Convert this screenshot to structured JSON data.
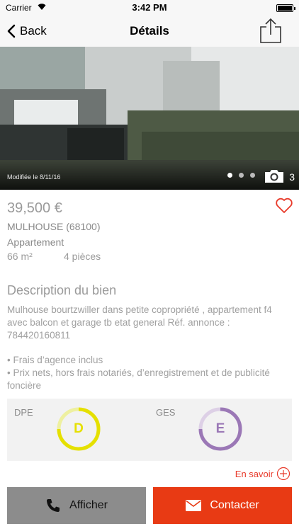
{
  "status_bar": {
    "carrier": "Carrier",
    "time": "3:42 PM",
    "battery_level": 1.0
  },
  "nav": {
    "back_label": "Back",
    "title": "Détails"
  },
  "photo": {
    "modified": "Modifiée le 8/11/16",
    "count": "3",
    "active_dot": 0
  },
  "listing": {
    "price": "39,500 €",
    "city": "MULHOUSE (68100)",
    "type": "Appartement",
    "area": "66 m²",
    "rooms": "4 pièces"
  },
  "description": {
    "title": "Description du bien",
    "text": "Mulhouse bourtzwiller   dans petite copropriété , appartement f4 avec balcon et garage tb etat general Réf. annonce : 784420160811",
    "bullet_1": "• Frais d’agence inclus",
    "bullet_2": "• Prix nets, hors frais notariés, d’enregistrement et de publicité foncière"
  },
  "energy": {
    "dpe_label": "DPE",
    "dpe_value": "D",
    "dpe_color": "#e5e000",
    "ges_label": "GES",
    "ges_value": "E",
    "ges_color": "#9b78b6"
  },
  "learn_more": "En savoir",
  "actions": {
    "show_label": "Afficher",
    "contact_label": "Contacter"
  },
  "colors": {
    "accent": "#e83a14",
    "heart": "#e83a2a",
    "show_button": "#8c8c8c"
  },
  "icons": [
    "wifi-icon",
    "battery-icon",
    "back-chevron-icon",
    "share-icon",
    "camera-icon",
    "heart-icon",
    "plus-circle-icon",
    "phone-icon",
    "envelope-icon"
  ]
}
